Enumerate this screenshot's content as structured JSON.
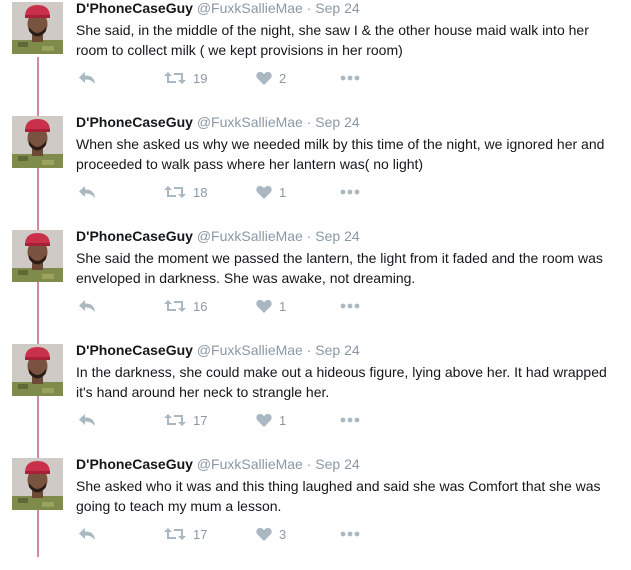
{
  "tweets": [
    {
      "name": "D'PhoneCaseGuy",
      "handle": "@FuxkSallieMae",
      "separator": "·",
      "date": "Sep 24",
      "text": "She said, in the middle of the night, she saw I & the other house maid walk into her room to collect milk ( we kept provisions in her room)",
      "retweets": "19",
      "likes": "2"
    },
    {
      "name": "D'PhoneCaseGuy",
      "handle": "@FuxkSallieMae",
      "separator": "·",
      "date": "Sep 24",
      "text": "When she asked us why we needed milk by this time of the night,  we ignored her and proceeded to walk pass where her lantern was( no light)",
      "retweets": "18",
      "likes": "1"
    },
    {
      "name": "D'PhoneCaseGuy",
      "handle": "@FuxkSallieMae",
      "separator": "·",
      "date": "Sep 24",
      "text": "She said the moment we passed the lantern,  the light from it faded and the room was enveloped in darkness.  She was  awake, not dreaming.",
      "retweets": "16",
      "likes": "1"
    },
    {
      "name": "D'PhoneCaseGuy",
      "handle": "@FuxkSallieMae",
      "separator": "·",
      "date": "Sep 24",
      "text": "In the darkness, she could make out a hideous figure,  lying above her.  It had wrapped it's hand around her neck to strangle her.",
      "retweets": "17",
      "likes": "1"
    },
    {
      "name": "D'PhoneCaseGuy",
      "handle": "@FuxkSallieMae",
      "separator": "·",
      "date": "Sep 24",
      "text": "She asked who it was and this thing laughed and said she was Comfort that she was going to teach my mum a lesson.",
      "retweets": "17",
      "likes": "3"
    }
  ],
  "icons": {
    "reply": "reply-icon",
    "retweet": "retweet-icon",
    "like": "heart-icon",
    "more": "more-icon"
  },
  "colors": {
    "thread_line": "#d08a9c",
    "icon_gray": "#aab8c2",
    "meta_gray": "#8b98a5",
    "text": "#14171a"
  }
}
